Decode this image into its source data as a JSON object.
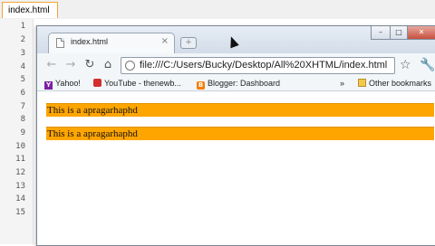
{
  "editor": {
    "tab_label": "index.html",
    "line_numbers": [
      "1",
      "2",
      "3",
      "4",
      "5",
      "6",
      "7",
      "8",
      "9",
      "10",
      "11",
      "12",
      "13",
      "14",
      "15"
    ]
  },
  "browser": {
    "tab_title": "index.html",
    "tab_close": "×",
    "new_tab": "+",
    "window_controls": {
      "minimize": "–",
      "maximize": "□",
      "close": "✕"
    },
    "nav": {
      "back": "←",
      "forward": "→",
      "reload": "↻",
      "home": "⌂"
    },
    "address": "file:///C:/Users/Bucky/Desktop/All%20XHTML/index.html",
    "bookmarks": [
      {
        "label": "Yahoo!",
        "icon": "yahoo-icon"
      },
      {
        "label": "YouTube - thenewb...",
        "icon": "youtube-icon"
      },
      {
        "label": "Blogger: Dashboard",
        "icon": "blogger-icon"
      }
    ],
    "bookmarks_overflow": "»",
    "other_bookmarks": "Other bookmarks"
  },
  "content": {
    "paragraphs": [
      "This is a apragarhaphd",
      "This is a apragarhaphd"
    ],
    "highlight_color": "#ffa500"
  }
}
